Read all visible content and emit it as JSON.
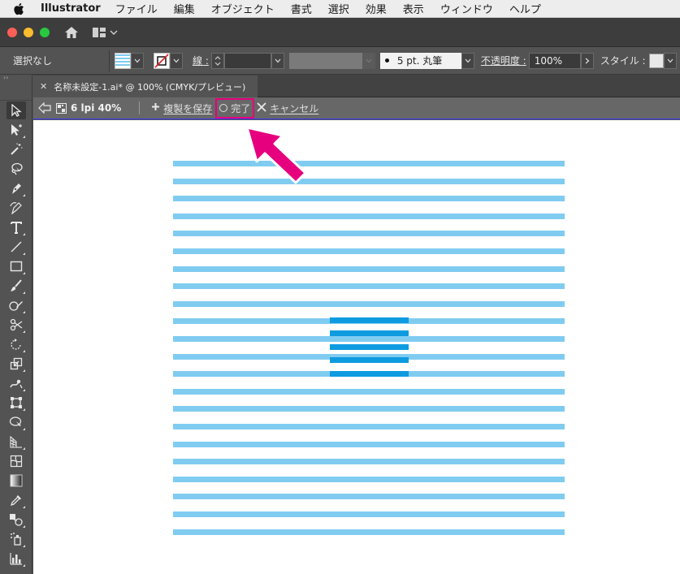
{
  "menubar": {
    "app_name": "Illustrator",
    "items": [
      "ファイル",
      "編集",
      "オブジェクト",
      "書式",
      "選択",
      "効果",
      "表示",
      "ウィンドウ",
      "ヘルプ"
    ]
  },
  "control": {
    "selection_label": "選択なし",
    "stroke_label": "線 :",
    "brush_label": "5 pt. 丸筆",
    "opacity_label": "不透明度 :",
    "opacity_value": "100%",
    "style_label": "スタイル :"
  },
  "document": {
    "tab_title": "名称未設定-1.ai* @ 100% (CMYK/プレビュー)"
  },
  "pattern_bar": {
    "pattern_name": "6 lpi 40%",
    "save_copy_label": "複製を保存",
    "done_label": "完了",
    "cancel_label": "キャンセル"
  },
  "colors": {
    "light_stripe": "#80ccf1",
    "dark_stripe": "#0e9be0",
    "highlight": "#e6007e"
  }
}
